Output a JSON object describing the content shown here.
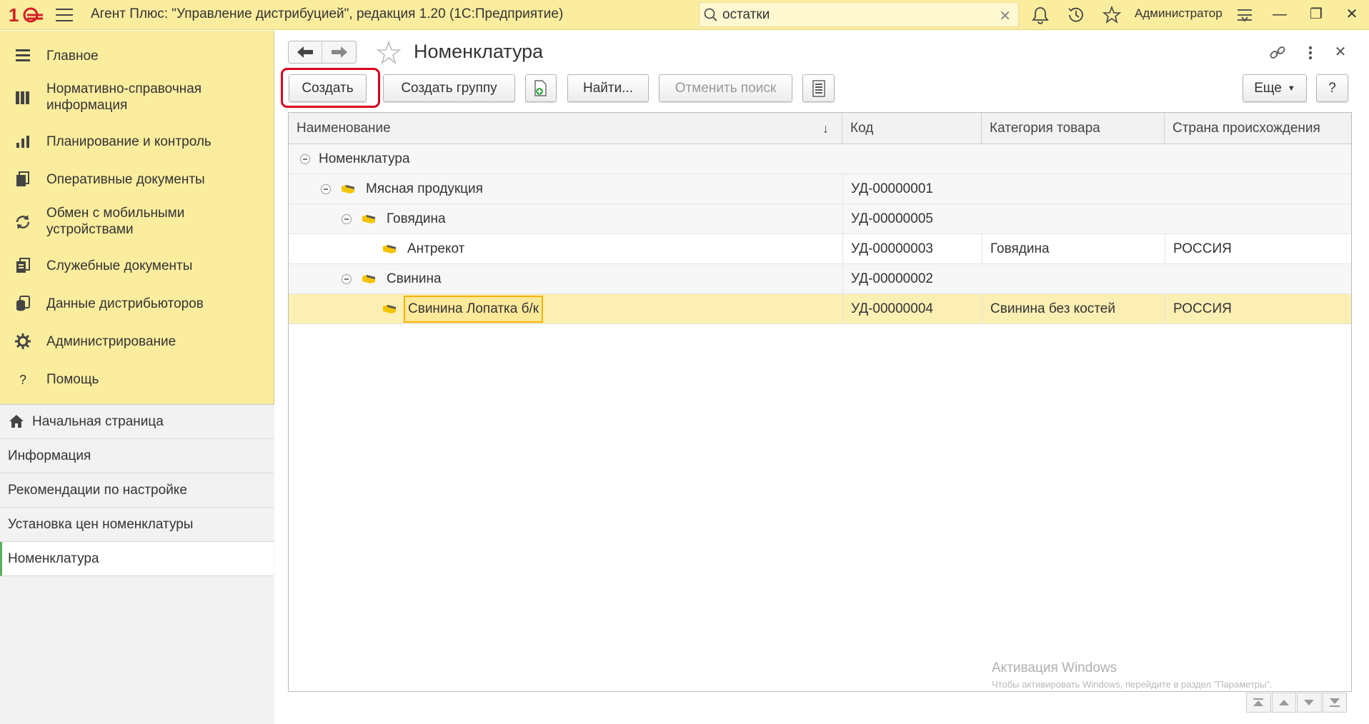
{
  "titlebar": {
    "app_title": "Агент Плюс: \"Управление дистрибуцией\", редакция 1.20  (1С:Предприятие)",
    "search_value": "остатки",
    "user_name": "Администратор"
  },
  "sidebar": {
    "items": [
      {
        "label": "Главное",
        "icon": "menu-lines-icon"
      },
      {
        "label": "Нормативно-справочная информация",
        "icon": "reference-icon"
      },
      {
        "label": "Планирование и контроль",
        "icon": "chart-icon"
      },
      {
        "label": "Оперативные документы",
        "icon": "documents-icon"
      },
      {
        "label": "Обмен с мобильными устройствами",
        "icon": "sync-icon"
      },
      {
        "label": "Служебные документы",
        "icon": "service-docs-icon"
      },
      {
        "label": "Данные дистрибьюторов",
        "icon": "database-icon"
      },
      {
        "label": "Администрирование",
        "icon": "gear-icon"
      },
      {
        "label": "Помощь",
        "icon": "question-icon"
      }
    ],
    "open_windows": [
      {
        "label": "Начальная страница"
      },
      {
        "label": "Информация"
      },
      {
        "label": "Рекомендации по настройке"
      },
      {
        "label": "Установка цен номенклатуры"
      },
      {
        "label": "Номенклатура"
      }
    ]
  },
  "main": {
    "title": "Номенклатура",
    "toolbar": {
      "create": "Создать",
      "create_group": "Создать группу",
      "find": "Найти...",
      "cancel_search": "Отменить поиск",
      "more": "Еще",
      "help": "?"
    },
    "table": {
      "columns": [
        "Наименование",
        "Код",
        "Категория товара",
        "Страна происхождения"
      ],
      "sort_indicator": "↓",
      "rows": [
        {
          "name": "Номенклатура",
          "code": "",
          "category": "",
          "country": ""
        },
        {
          "name": "Мясная продукция",
          "code": "УД-00000001",
          "category": "",
          "country": ""
        },
        {
          "name": "Говядина",
          "code": "УД-00000005",
          "category": "",
          "country": ""
        },
        {
          "name": "Антрекот",
          "code": "УД-00000003",
          "category": "Говядина",
          "country": "РОССИЯ"
        },
        {
          "name": "Свинина",
          "code": "УД-00000002",
          "category": "",
          "country": ""
        },
        {
          "name": "Свинина Лопатка б/к",
          "code": "УД-00000004",
          "category": "Свинина без костей",
          "country": "РОССИЯ"
        }
      ]
    }
  },
  "watermark": {
    "line1": "Активация Windows",
    "line2": "Чтобы активировать Windows, перейдите в раздел \"Параметры\"."
  }
}
